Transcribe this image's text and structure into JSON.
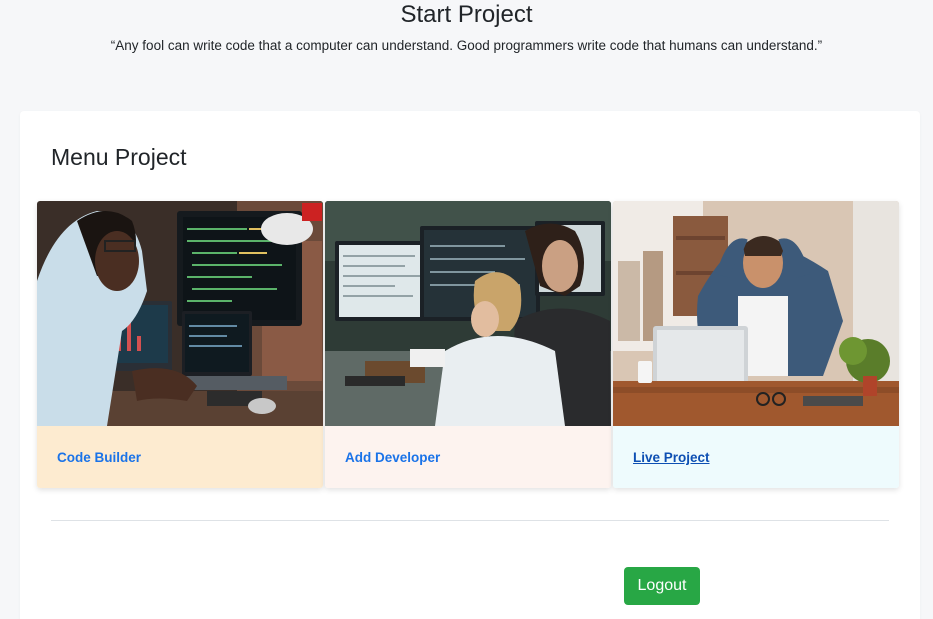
{
  "header": {
    "title": "Start Project",
    "quote": "“Any fool can write code that a computer can understand. Good programmers write code that humans can understand.”"
  },
  "menu": {
    "title": "Menu Project",
    "tiles": [
      {
        "label": "Code Builder",
        "footer_color": "#fdebd0",
        "state": "normal"
      },
      {
        "label": "Add Developer",
        "footer_color": "#fdf3ef",
        "state": "normal"
      },
      {
        "label": "Live Project",
        "footer_color": "#eefbfd",
        "state": "hover"
      }
    ]
  },
  "actions": {
    "logout_label": "Logout",
    "logout_color": "#28a745"
  }
}
